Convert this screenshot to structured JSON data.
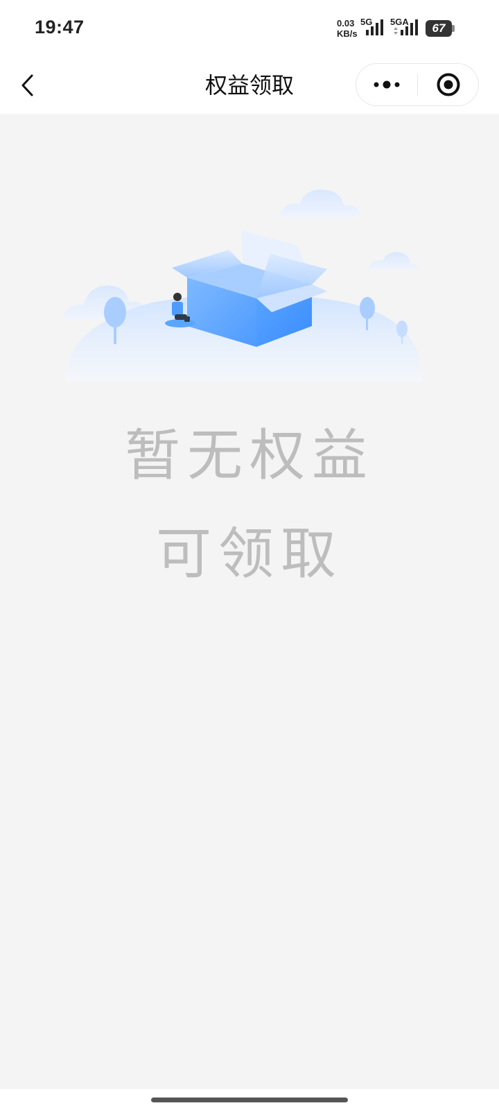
{
  "status_bar": {
    "time": "19:47",
    "net_speed_value": "0.03",
    "net_speed_unit": "KB/s",
    "sim1_label": "5G",
    "sim2_label": "5GA",
    "battery_level": "67",
    "signal_icon": "cellular-signal-icon",
    "battery_icon": "battery-icon"
  },
  "nav": {
    "title": "权益领取",
    "back_icon": "chevron-left-icon",
    "more_icon": "more-dots-icon",
    "close_icon": "target-circle-icon"
  },
  "empty_state": {
    "illustration": "empty-box-illustration",
    "line1": "暂无权益",
    "line2": "可领取"
  },
  "colors": {
    "page_background": "#f4f4f4",
    "empty_text": "#bdbdbd",
    "box_blue": "#5aa6ff"
  }
}
